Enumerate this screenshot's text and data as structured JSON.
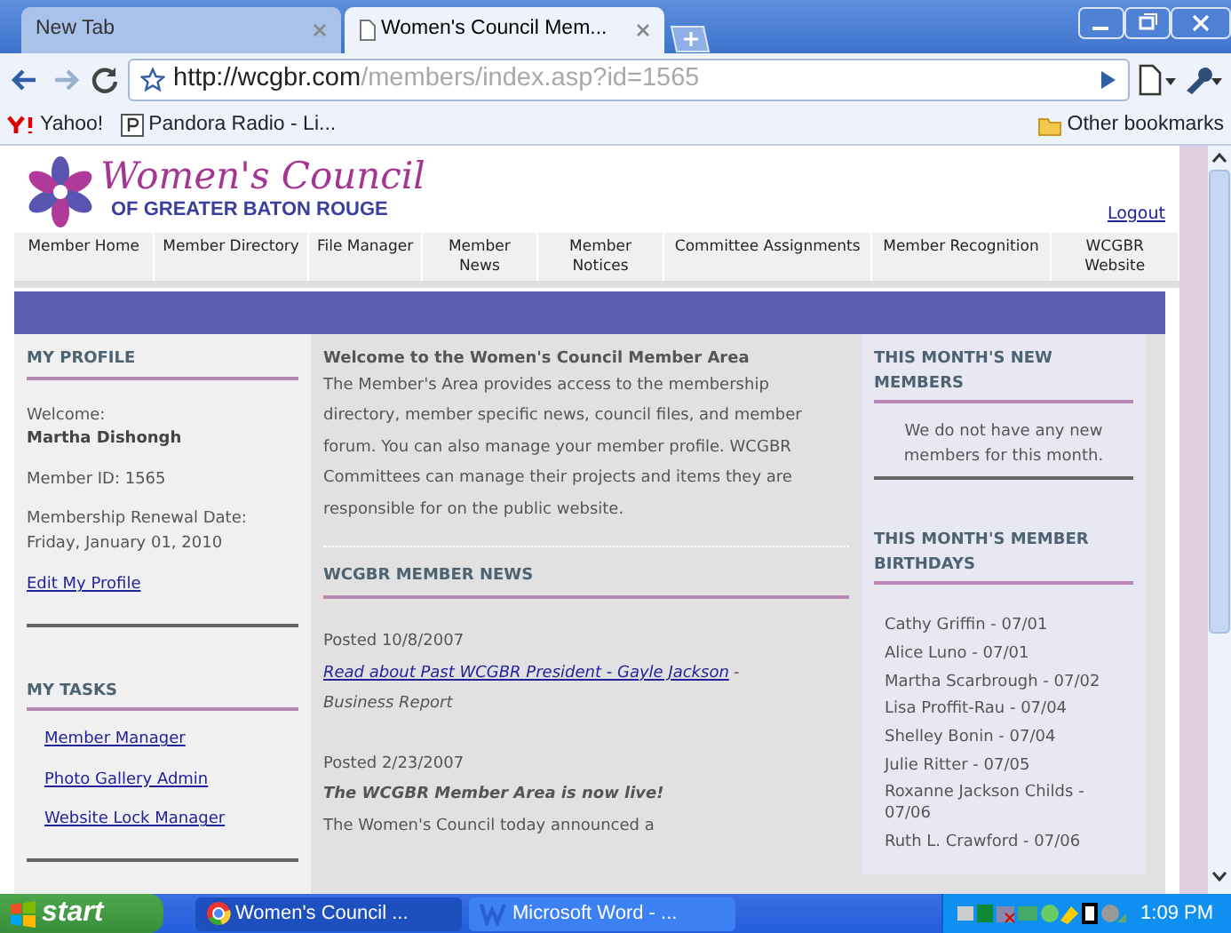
{
  "browser": {
    "tabs": [
      {
        "title": "New Tab",
        "selected": false
      },
      {
        "title": "Women's Council Mem...",
        "selected": true
      }
    ],
    "url": {
      "host": "http://wcgbr.com",
      "path": "/members/index.asp?id=1565"
    },
    "bookmarks": [
      {
        "label": "Yahoo!",
        "kind": "yahoo"
      },
      {
        "label": "Pandora Radio - Li...",
        "kind": "pandora"
      }
    ],
    "other_bookmarks": "Other bookmarks"
  },
  "site": {
    "logo": {
      "title": "Women's Council",
      "subtitle": "OF GREATER BATON ROUGE"
    },
    "logout": "Logout",
    "nav": [
      "Member Home",
      "Member Directory",
      "File Manager",
      "Member News",
      "Member Notices",
      "Committee Assignments",
      "Member Recognition",
      "WCGBR Website"
    ],
    "profile": {
      "heading": "MY PROFILE",
      "welcome_label": "Welcome:",
      "name": "Martha Dishongh",
      "member_id": "Member ID: 1565",
      "renewal_label": "Membership Renewal Date:",
      "renewal_date": "Friday, January 01, 2010",
      "edit_link": "Edit My Profile"
    },
    "tasks": {
      "heading": "MY TASKS",
      "links": [
        "Member Manager",
        "Photo Gallery Admin",
        "Website Lock Manager"
      ]
    },
    "welcome": {
      "heading": "Welcome to the Women's Council Member Area",
      "body": "The Member's Area provides access to the membership directory, member specific news, council files, and member forum. You can also manage your member profile. WCGBR Committees can manage their projects and items they are responsible for on the public website."
    },
    "news": {
      "heading": "WCGBR MEMBER NEWS",
      "items": [
        {
          "kind": "link",
          "posted": "Posted 10/8/2007",
          "title": "Read about Past WCGBR President - Gayle Jackson",
          "separator": "-",
          "note": "Business Report"
        },
        {
          "kind": "headline",
          "posted": "Posted 2/23/2007",
          "title": "The WCGBR Member Area is now live!",
          "note": "The Women's Council today announced a"
        }
      ]
    },
    "new_members": {
      "heading": "THIS MONTH'S NEW MEMBERS",
      "message": "We do not have any new members for this month."
    },
    "birthdays": {
      "heading": "THIS MONTH'S MEMBER BIRTHDAYS",
      "items": [
        "Cathy Griffin - 07/01",
        "Alice Luno - 07/01",
        "Martha Scarbrough - 07/02",
        "Lisa Proffit-Rau - 07/04",
        "Shelley Bonin - 07/04",
        "Julie Ritter - 07/05",
        "Roxanne Jackson Childs - 07/06",
        "Ruth L. Crawford - 07/06"
      ]
    }
  },
  "taskbar": {
    "start": "start",
    "items": [
      {
        "label": "Women's Council ...",
        "kind": "chrome",
        "selected": true
      },
      {
        "label": "Microsoft Word - ...",
        "kind": "word",
        "selected": false
      }
    ],
    "clock": "1:09 PM"
  }
}
